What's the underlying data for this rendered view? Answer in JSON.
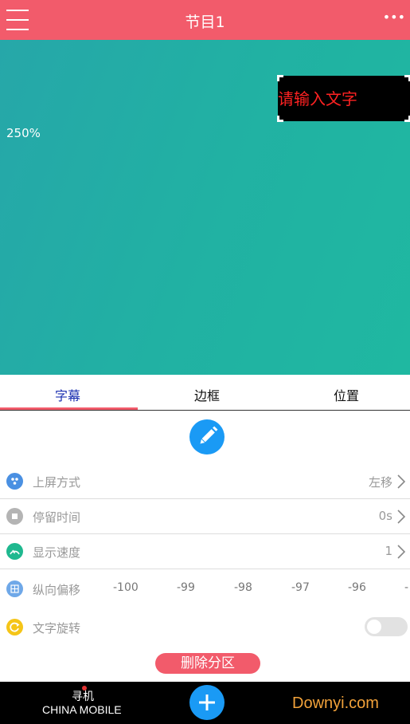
{
  "header": {
    "title": "节目1",
    "more_icon": "more-horizontal-icon",
    "menu_icon": "hamburger-menu-icon",
    "bg_color": "#f25b6b"
  },
  "preview": {
    "zoom_level": "250%",
    "text_box_text": "请输入文字",
    "text_color": "#ff2222",
    "bg_color": "#21b1a3"
  },
  "tabs": [
    {
      "label": "字幕",
      "active": true
    },
    {
      "label": "边框",
      "active": false
    },
    {
      "label": "位置",
      "active": false
    }
  ],
  "edit_icon": "pencil-icon",
  "settings": {
    "entry_mode": {
      "label": "上屏方式",
      "value": "左移",
      "icon": "dots-icon"
    },
    "stay_time": {
      "label": "停留时间",
      "value": "0s",
      "icon": "stop-icon"
    },
    "display_speed": {
      "label": "显示速度",
      "value": "1",
      "icon": "speedometer-icon"
    },
    "vertical_offset": {
      "label": "纵向偏移",
      "icon": "grid-icon",
      "options": [
        "-100",
        "-99",
        "-98",
        "-97",
        "-96",
        "-"
      ]
    },
    "text_rotation": {
      "label": "文字旋转",
      "icon": "rotate-icon",
      "enabled": false
    }
  },
  "delete_button": "删除分区",
  "status_bar": {
    "carrier_line1": "寻机",
    "carrier_line2": "CHINA MOBILE",
    "add_icon": "plus-icon",
    "watermark": "Downyi.com"
  },
  "colors": {
    "accent": "#f25b6b",
    "blue": "#1a9af5",
    "active_tab": "#1a2fb0"
  }
}
